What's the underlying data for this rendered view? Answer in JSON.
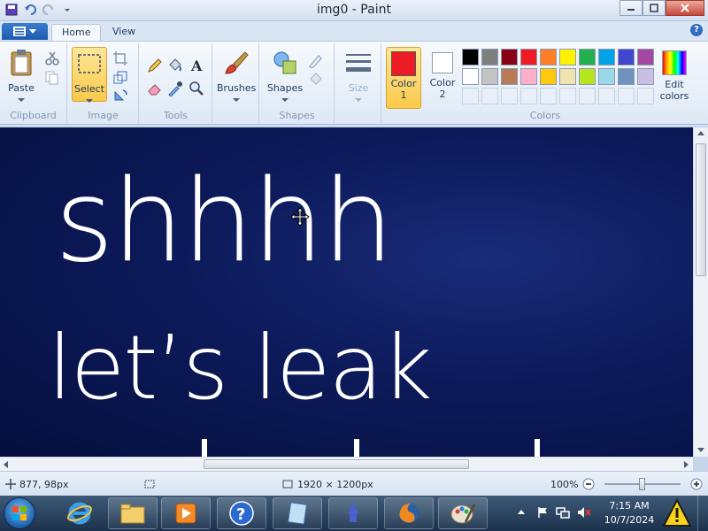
{
  "window": {
    "title": "img0 - Paint"
  },
  "tabs": [
    {
      "label": "Home"
    },
    {
      "label": "View"
    }
  ],
  "ribbon": {
    "clipboard": {
      "paste": "Paste",
      "label": "Clipboard"
    },
    "image": {
      "select": "Select",
      "label": "Image"
    },
    "tools": {
      "label": "Tools"
    },
    "brushes": {
      "label": "Brushes"
    },
    "shapes": {
      "button": "Shapes",
      "label": "Shapes"
    },
    "size": {
      "label": "Size"
    },
    "colors": {
      "color1_line1": "Color",
      "color1_line2": "1",
      "color2_line1": "Color",
      "color2_line2": "2",
      "edit_line1": "Edit",
      "edit_line2": "colors",
      "label": "Colors",
      "color1": "#ed1c24",
      "color2": "#ffffff",
      "palette_row1": [
        "#000000",
        "#7f7f7f",
        "#880015",
        "#ed1c24",
        "#ff7f27",
        "#fff200",
        "#22b14c",
        "#00a2e8",
        "#3f48cc",
        "#a349a4"
      ],
      "palette_row2": [
        "#ffffff",
        "#c3c3c3",
        "#b97a57",
        "#ffaec9",
        "#ffc90e",
        "#efe4b0",
        "#b5e61d",
        "#99d9ea",
        "#7092be",
        "#c8bfe7"
      ]
    }
  },
  "canvas": {
    "line1": "shhhh",
    "line2": "let’s leak"
  },
  "status": {
    "cursor_pos": "877, 98px",
    "image_size": "1920 × 1200px",
    "zoom": "100%"
  },
  "taskbar": {
    "time": "7:15 AM",
    "date": "10/7/2024"
  }
}
